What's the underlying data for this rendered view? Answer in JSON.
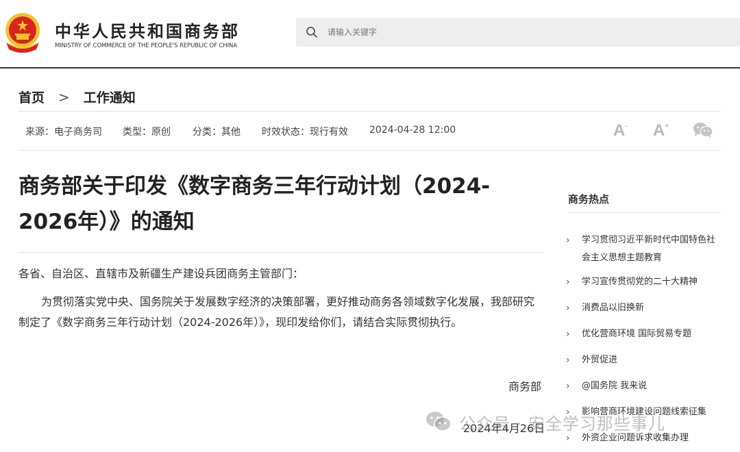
{
  "header": {
    "site_title_cn": "中华人民共和国商务部",
    "site_title_en": "MINISTRY OF COMMERCE OF THE PEOPLE'S REPUBLIC OF CHINA",
    "search_placeholder": "请输入关键字"
  },
  "breadcrumb": {
    "home": "首页",
    "separator": ">",
    "current": "工作通知"
  },
  "meta": {
    "source": "来源：电子商务司",
    "type": "类型：原创",
    "category": "分类：其他",
    "status": "时效状态：现行有效",
    "date": "2024-04-28 12:00"
  },
  "article": {
    "title": "商务部关于印发《数字商务三年行动计划（2024-2026年）》的通知",
    "greeting": "各省、自治区、直辖市及新疆生产建设兵团商务主管部门：",
    "body": "为贯彻落实党中央、国务院关于发展数字经济的决策部署，更好推动商务各领域数字化发展，我部研究制定了《数字商务三年行动计划（2024-2026年）》，现印发给你们，请结合实际贯彻执行。",
    "signature": "商务部",
    "sign_date": "2024年4月26日"
  },
  "sidebar": {
    "title": "商务热点",
    "items": [
      {
        "label": "学习贯彻习近平新时代中国特色社会主义思想主题教育"
      },
      {
        "label": "学习宣传贯彻党的二十大精神"
      },
      {
        "label": "消费品以旧换新"
      },
      {
        "label": "优化营商环境 国际贸易专题"
      },
      {
        "label": "外贸促进"
      },
      {
        "label": "@国务院 我来说"
      },
      {
        "label": "影响营商环境建设问题线索征集"
      },
      {
        "label": "外资企业问题诉求收集办理"
      }
    ]
  },
  "watermark": {
    "text": "公众号 · 安全学习那些事儿"
  },
  "icons": {
    "emblem": "national-emblem-icon",
    "search": "search-icon",
    "font_size_down": "font-size-decrease-icon",
    "font_size_up": "font-size-increase-icon",
    "share": "wechat-share-icon",
    "chevron": "chevron-right-icon"
  },
  "colors": {
    "emblem_red": "#d6261c",
    "emblem_gold": "#f2c22d",
    "header_rule": "#333333",
    "search_bg": "#eeeeee"
  }
}
